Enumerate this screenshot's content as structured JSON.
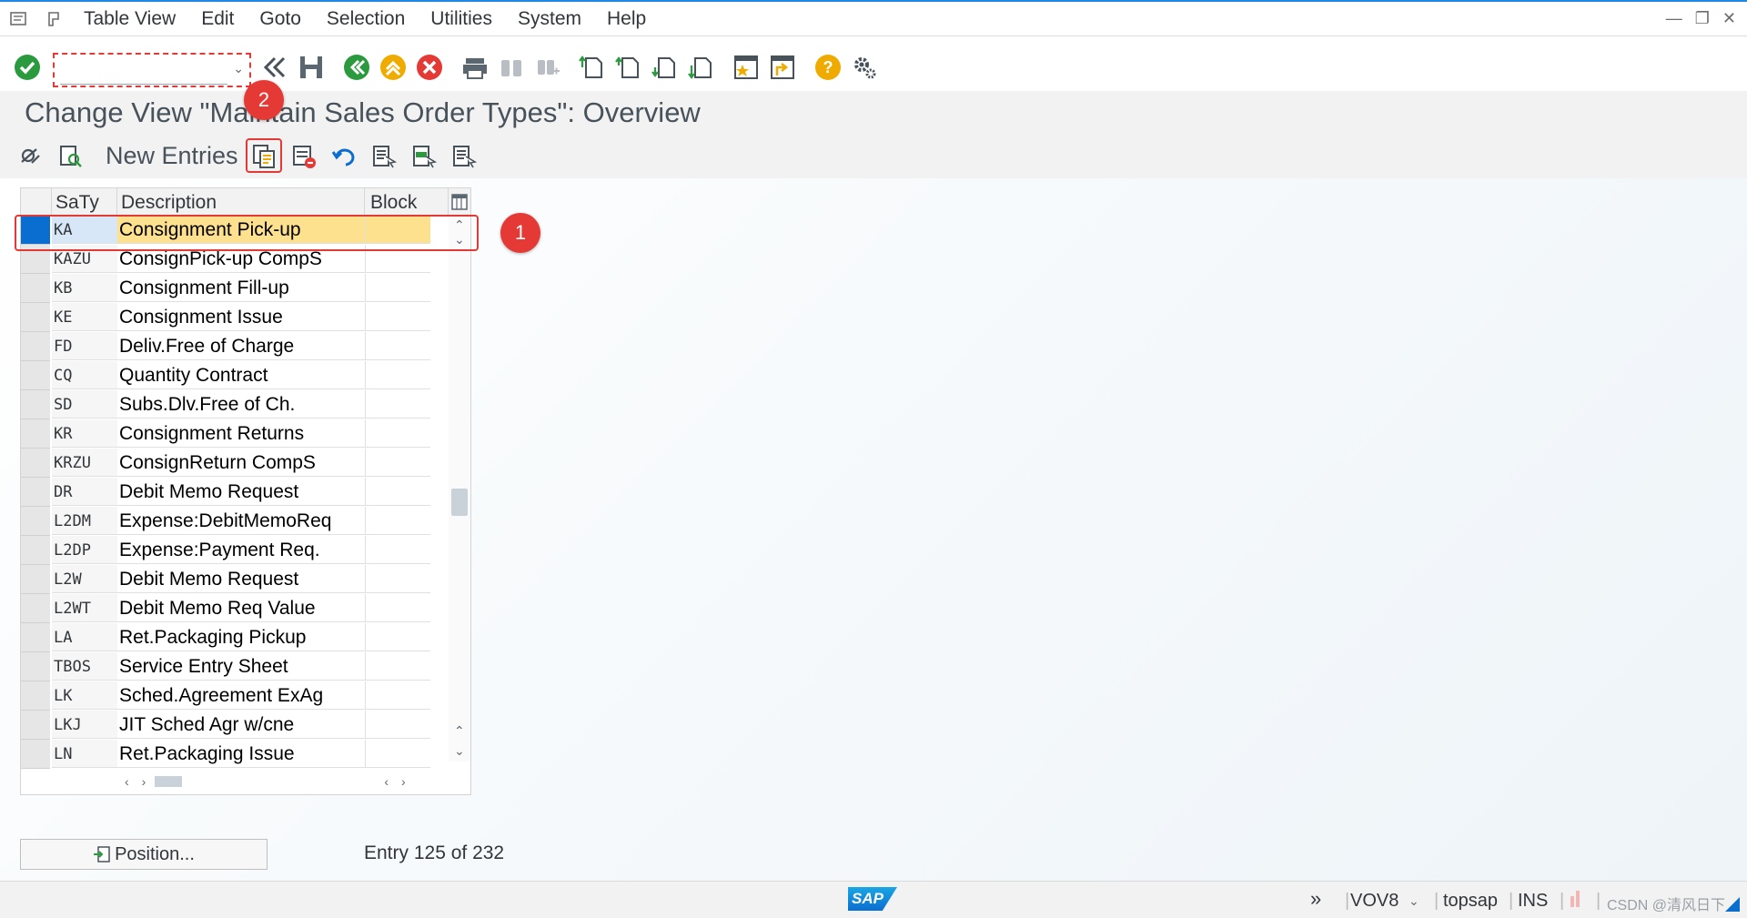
{
  "menubar": {
    "items": [
      "Table View",
      "Edit",
      "Goto",
      "Selection",
      "Utilities",
      "System",
      "Help"
    ]
  },
  "command_field": {
    "value": ""
  },
  "title": "Change View \"Maintain Sales Order Types\": Overview",
  "app_toolbar": {
    "new_entries": "New Entries"
  },
  "badges": {
    "one": "1",
    "two": "2"
  },
  "table": {
    "columns": [
      "SaTy",
      "Description",
      "Block"
    ],
    "rows": [
      {
        "code": "KA",
        "desc": "Consignment Pick-up",
        "selected": true
      },
      {
        "code": "KAZU",
        "desc": "ConsignPick-up CompS"
      },
      {
        "code": "KB",
        "desc": "Consignment Fill-up"
      },
      {
        "code": "KE",
        "desc": "Consignment Issue"
      },
      {
        "code": "FD",
        "desc": "Deliv.Free of Charge"
      },
      {
        "code": "CQ",
        "desc": "Quantity Contract"
      },
      {
        "code": "SD",
        "desc": "Subs.Dlv.Free of Ch."
      },
      {
        "code": "KR",
        "desc": "Consignment Returns"
      },
      {
        "code": "KRZU",
        "desc": "ConsignReturn CompS"
      },
      {
        "code": "DR",
        "desc": "Debit Memo Request"
      },
      {
        "code": "L2DM",
        "desc": "Expense:DebitMemoReq"
      },
      {
        "code": "L2DP",
        "desc": "Expense:Payment Req."
      },
      {
        "code": "L2W",
        "desc": "Debit Memo Request"
      },
      {
        "code": "L2WT",
        "desc": "Debit Memo Req Value"
      },
      {
        "code": "LA",
        "desc": "Ret.Packaging Pickup"
      },
      {
        "code": "TBOS",
        "desc": "Service Entry Sheet"
      },
      {
        "code": "LK",
        "desc": "Sched.Agreement ExAg"
      },
      {
        "code": "LKJ",
        "desc": "JIT Sched Agr w/cne"
      },
      {
        "code": "LN",
        "desc": "Ret.Packaging Issue"
      }
    ]
  },
  "footer": {
    "position_button": "Position...",
    "entry_text": "Entry 125 of 232"
  },
  "statusbar": {
    "logo": "SAP",
    "transaction": "VOV8",
    "system": "topsap",
    "mode": "INS",
    "watermark": "CSDN @清风日下"
  },
  "colors": {
    "accent": "#0a6ed1",
    "highlight_row": "#fde18e",
    "annotation_red": "#e53935"
  }
}
